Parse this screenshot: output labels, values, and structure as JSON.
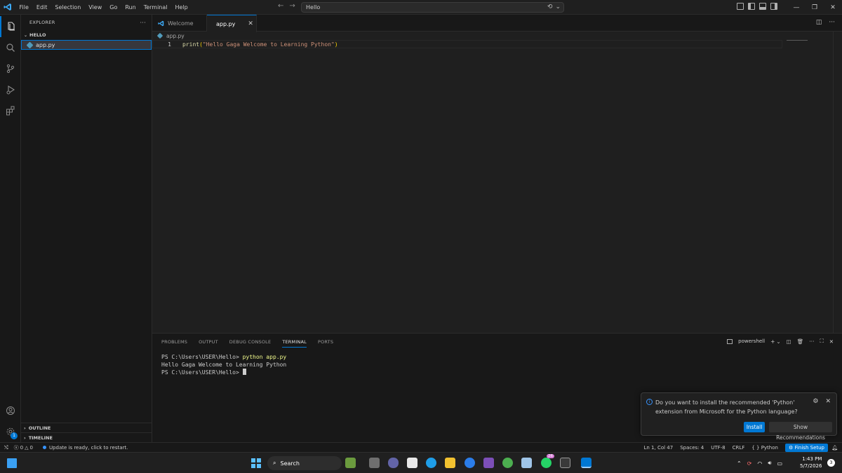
{
  "titlebar": {
    "menus": [
      "File",
      "Edit",
      "Selection",
      "View",
      "Go",
      "Run",
      "Terminal",
      "Help"
    ],
    "search_text": "Hello"
  },
  "sidebar": {
    "header": "EXPLORER",
    "folder": "HELLO",
    "file": "app.py",
    "outline": "OUTLINE",
    "timeline": "TIMELINE"
  },
  "activity": {
    "settings_badge": "1"
  },
  "tabs": [
    {
      "label": "Welcome",
      "active": false
    },
    {
      "label": "app.py",
      "active": true
    }
  ],
  "editor": {
    "breadcrumb": "app.py",
    "line_number": "1",
    "code_fn": "print",
    "code_open": "(",
    "code_string": "\"Hello Gaga Welcome to Learning Python\"",
    "code_close": ")"
  },
  "panel": {
    "tabs": [
      "PROBLEMS",
      "OUTPUT",
      "DEBUG CONSOLE",
      "TERMINAL",
      "PORTS"
    ],
    "active_tab": "TERMINAL",
    "shell": "powershell",
    "terminal_lines": [
      {
        "prompt": "PS C:\\Users\\USER\\Hello> ",
        "command": "python app.py"
      },
      {
        "output": "Hello Gaga Welcome to Learning Python"
      },
      {
        "prompt": "PS C:\\Users\\USER\\Hello> "
      }
    ]
  },
  "notification": {
    "message": "Do you want to install the recommended 'Python' extension from Microsoft for the Python language?",
    "install_label": "Install",
    "recommend_label": "Show Recommendations"
  },
  "statusbar": {
    "errors": "0",
    "warnings": "0",
    "update_text": "Update is ready, click to restart.",
    "position": "Ln 1, Col 47",
    "spaces": "Spaces: 4",
    "encoding": "UTF-8",
    "eol": "CRLF",
    "language": "Python",
    "finish_setup": "Finish Setup"
  },
  "taskbar": {
    "search_label": "Search",
    "time": "1:43 PM",
    "date": "5/7/2026",
    "notification_count": "3",
    "whatsapp_badge": "26"
  },
  "colors": {
    "accent": "#0078d4",
    "editor_bg": "#1f1f1f",
    "sidebar_bg": "#181818"
  }
}
